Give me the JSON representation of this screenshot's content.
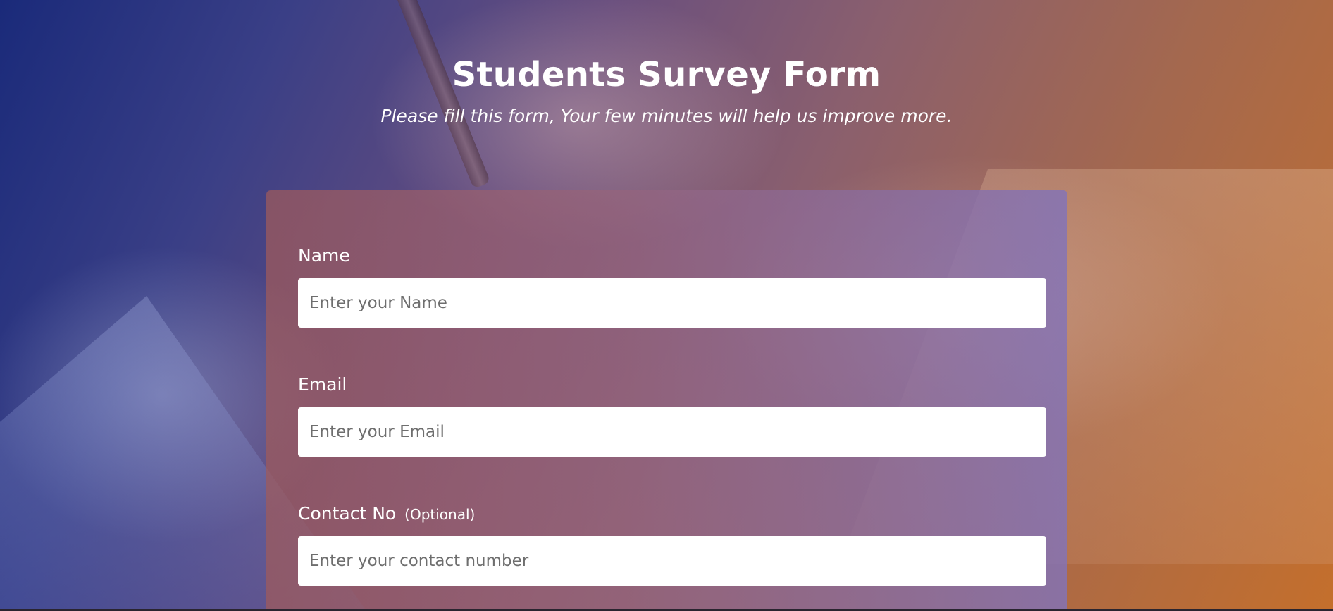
{
  "header": {
    "title": "Students Survey Form",
    "subtitle": "Please fill this form, Your few minutes will help us improve more."
  },
  "form": {
    "name": {
      "label": "Name",
      "placeholder": "Enter your Name"
    },
    "email": {
      "label": "Email",
      "placeholder": "Enter your Email"
    },
    "contact": {
      "label": "Contact No",
      "optional": "(Optional)",
      "placeholder": "Enter your contact number"
    }
  },
  "colors": {
    "gradient_start": "#1a2a7a",
    "gradient_end": "#c46f2c",
    "text": "#ffffff",
    "input_bg": "#ffffff"
  }
}
